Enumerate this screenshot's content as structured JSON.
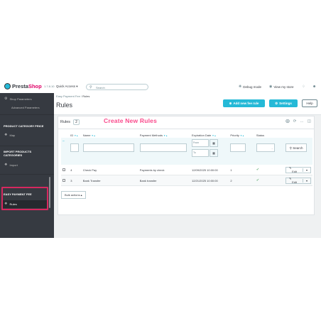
{
  "topbar": {
    "logo_presta": "Presta",
    "logo_shop": "Shop",
    "version": "1.7.8.10",
    "quick_access": "Quick Access ▾",
    "search_placeholder": "Search",
    "debug_mode": "Debug mode",
    "view_store": "View my store"
  },
  "sidebar": {
    "shop_parameters": "Shop Parameters",
    "advanced_parameters": "Advanced Parameters",
    "product_category_price": "PRODUCT CATEGORY PRICE",
    "map": "Map",
    "import_products_categories": "IMPORT PRODUCTS CATEGORIES",
    "import": "Import",
    "easy_payment_fee": "EASY PAYMENT FEE",
    "rules": "Rules"
  },
  "header": {
    "breadcrumb_parent": "Easy Payment Fee",
    "breadcrumb_sep": "/",
    "breadcrumb_current": "Rules",
    "title": "Rules",
    "add_button": "Add new fee rule",
    "settings_button": "Settings",
    "help_button": "Help"
  },
  "callout": "Create New Rules",
  "panel": {
    "title": "Rules",
    "count": "2",
    "columns": [
      "ID",
      "Name",
      "Payment Methods",
      "Expiration Date",
      "Priority",
      "Status"
    ],
    "from_placeholder": "From",
    "to_placeholder": "To",
    "status_select": "-",
    "search_button": "Search",
    "rows": [
      {
        "id": "4",
        "name": "Check Pay",
        "payment": "Payments by check",
        "expiration": "12/09/2025 10:00:00",
        "priority": "1",
        "status": "✔",
        "action": "Edit"
      },
      {
        "id": "3",
        "name": "Bank Transfer",
        "payment": "Bank transfer",
        "expiration": "12/21/2025 10:00:00",
        "priority": "2",
        "status": "✔",
        "action": "Edit"
      }
    ],
    "bulk_actions": "Bulk actions ▴"
  },
  "colors": {
    "accent": "#25b9d7",
    "callout": "#fa4a8c",
    "highlight": "#d6285f",
    "sidebar": "#363a41"
  }
}
